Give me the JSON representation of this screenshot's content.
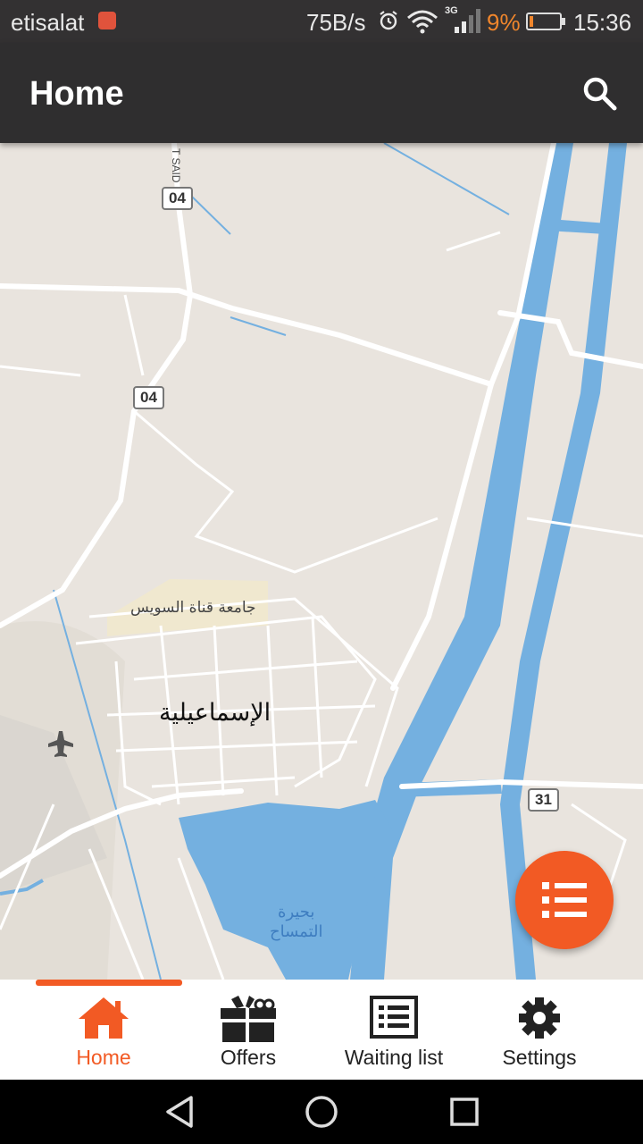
{
  "status_bar": {
    "carrier": "etisalat",
    "speed": "75B/s",
    "network": "3G",
    "battery_percent": "9%",
    "battery_level": 0.09,
    "time": "15:36"
  },
  "app_bar": {
    "title": "Home",
    "search_icon": "search-icon"
  },
  "map": {
    "city_label": "الإسماعيلية",
    "university_label": "جامعة قناة السويس",
    "lake_label_line1": "بحيرة",
    "lake_label_line2": "التمساح",
    "road_shields": [
      "04",
      "04",
      "31"
    ],
    "road_name": "T SAID",
    "colors": {
      "land": "#E9E4DE",
      "water": "#74B0E0",
      "road": "#FFFFFF"
    }
  },
  "fab": {
    "icon": "list-icon",
    "color": "#F25A24"
  },
  "bottom_nav": {
    "items": [
      {
        "label": "Home",
        "icon": "home-icon",
        "active": true
      },
      {
        "label": "Offers",
        "icon": "gift-icon",
        "active": false
      },
      {
        "label": "Waiting list",
        "icon": "list-alt-icon",
        "active": false
      },
      {
        "label": "Settings",
        "icon": "gear-icon",
        "active": false
      }
    ],
    "accent": "#F25A24"
  }
}
